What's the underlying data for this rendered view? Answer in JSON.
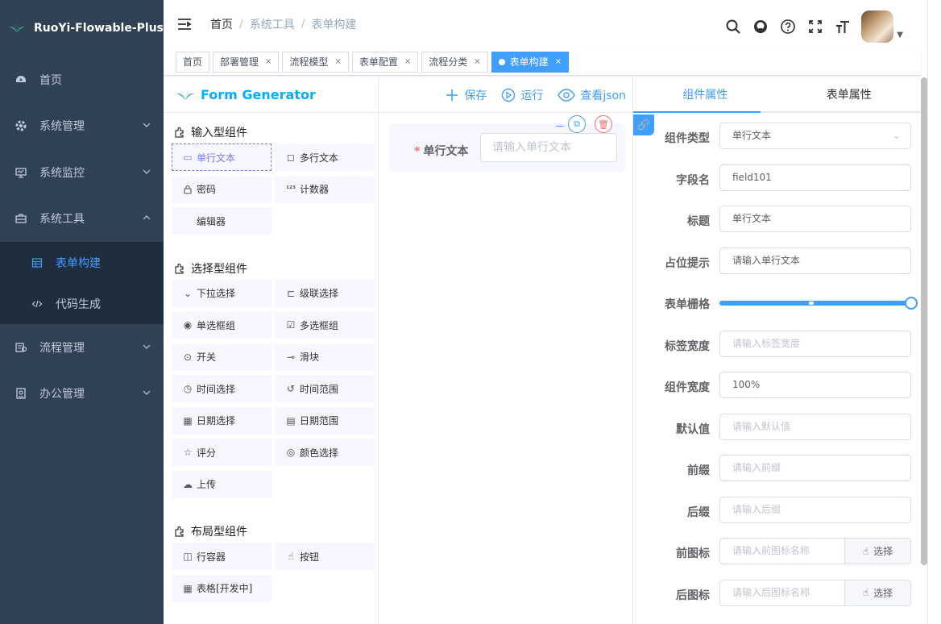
{
  "app": {
    "title": "RuoYi-Flowable-Plus"
  },
  "sidebar": {
    "items": [
      {
        "label": "首页",
        "icon": "dashboard-icon"
      },
      {
        "label": "系统管理",
        "icon": "system-icon"
      },
      {
        "label": "系统监控",
        "icon": "monitor-icon"
      },
      {
        "label": "系统工具",
        "icon": "tool-icon"
      },
      {
        "label": "流程管理",
        "icon": "process-icon"
      },
      {
        "label": "办公管理",
        "icon": "office-icon"
      }
    ],
    "sub_items": [
      {
        "label": "表单构建",
        "icon": "form-icon",
        "active": true
      },
      {
        "label": "代码生成",
        "icon": "code-icon",
        "active": false
      }
    ]
  },
  "breadcrumb": [
    "首页",
    "系统工具",
    "表单构建"
  ],
  "tags": [
    {
      "label": "首页"
    },
    {
      "label": "部署管理"
    },
    {
      "label": "流程模型"
    },
    {
      "label": "表单配置"
    },
    {
      "label": "流程分类"
    },
    {
      "label": "表单构建",
      "active": true
    }
  ],
  "generator": {
    "title": "Form Generator"
  },
  "actions": {
    "save": "保存",
    "run": "运行",
    "view_json": "查看json"
  },
  "groups": {
    "input": {
      "title": "输入型组件",
      "items": [
        {
          "label": "单行文本",
          "icon": "▭",
          "selected": true
        },
        {
          "label": "多行文本",
          "icon": "◻"
        },
        {
          "label": "密码",
          "icon": "🔒"
        },
        {
          "label": "计数器",
          "icon": "¹²³"
        },
        {
          "label": "编辑器",
          "icon": ""
        }
      ]
    },
    "select": {
      "title": "选择型组件",
      "items": [
        {
          "label": "下拉选择",
          "icon": "⌄"
        },
        {
          "label": "级联选择",
          "icon": "⊏"
        },
        {
          "label": "单选框组",
          "icon": "◉"
        },
        {
          "label": "多选框组",
          "icon": "☑"
        },
        {
          "label": "开关",
          "icon": "⊙"
        },
        {
          "label": "滑块",
          "icon": "⊸"
        },
        {
          "label": "时间选择",
          "icon": "◷"
        },
        {
          "label": "时间范围",
          "icon": "↺"
        },
        {
          "label": "日期选择",
          "icon": "▦"
        },
        {
          "label": "日期范围",
          "icon": "▤"
        },
        {
          "label": "评分",
          "icon": "☆"
        },
        {
          "label": "颜色选择",
          "icon": "◎"
        },
        {
          "label": "上传",
          "icon": "☁"
        }
      ]
    },
    "layout": {
      "title": "布局型组件",
      "items": [
        {
          "label": "行容器",
          "icon": "◫"
        },
        {
          "label": "按钮",
          "icon": "☝"
        },
        {
          "label": "表格[开发中]",
          "icon": "▦"
        }
      ]
    }
  },
  "canvas": {
    "field": {
      "required_mark": "*",
      "label": "单行文本",
      "placeholder": "请输入单行文本"
    }
  },
  "right_panel": {
    "tabs": [
      "组件属性",
      "表单属性"
    ],
    "props": [
      {
        "label": "组件类型",
        "value": "单行文本",
        "type": "select"
      },
      {
        "label": "字段名",
        "value": "field101"
      },
      {
        "label": "标题",
        "value": "单行文本"
      },
      {
        "label": "占位提示",
        "value": "请输入单行文本"
      },
      {
        "label": "表单栅格",
        "type": "slider",
        "slider_value": 1.0
      },
      {
        "label": "标签宽度",
        "placeholder": "请输入标签宽度"
      },
      {
        "label": "组件宽度",
        "value": "100%"
      },
      {
        "label": "默认值",
        "placeholder": "请输入默认值"
      },
      {
        "label": "前缀",
        "placeholder": "请输入前缀"
      },
      {
        "label": "后缀",
        "placeholder": "请输入后缀"
      },
      {
        "label": "前图标",
        "placeholder": "请输入前图标名称",
        "button": "选择"
      },
      {
        "label": "后图标",
        "placeholder": "请输入后图标名称",
        "button": "选择"
      }
    ]
  },
  "colors": {
    "sidebar_bg": "#304156",
    "accent": "#409eff",
    "danger": "#f56c6c",
    "component_bg": "#f6f7ff"
  }
}
